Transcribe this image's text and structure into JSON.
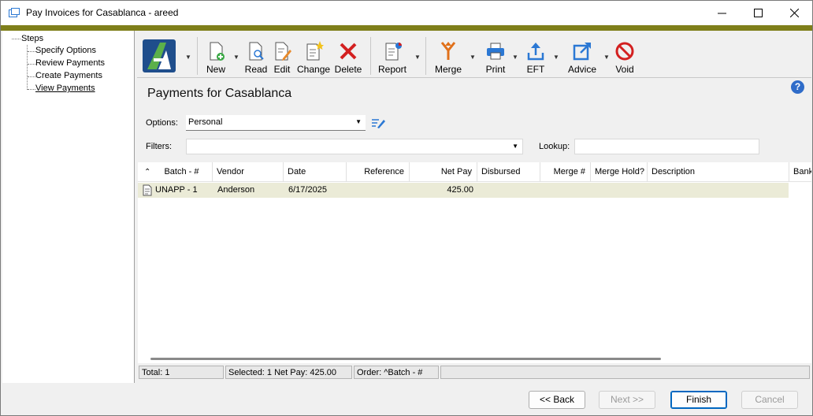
{
  "window": {
    "title": "Pay Invoices for Casablanca - areed",
    "minimize_icon": "minimize-icon",
    "maximize_icon": "maximize-icon",
    "close_icon": "close-icon"
  },
  "steps": {
    "root": "Steps",
    "items": [
      {
        "label": "Specify Options",
        "active": false
      },
      {
        "label": "Review Payments",
        "active": false
      },
      {
        "label": "Create Payments",
        "active": false
      },
      {
        "label": "View Payments",
        "active": true
      }
    ]
  },
  "toolbar": {
    "buttons": [
      {
        "label": "New",
        "icon": "new-document-icon"
      },
      {
        "label": "Read",
        "icon": "read-icon"
      },
      {
        "label": "Edit",
        "icon": "edit-icon"
      },
      {
        "label": "Change",
        "icon": "change-icon"
      },
      {
        "label": "Delete",
        "icon": "delete-icon"
      },
      {
        "label": "Report",
        "icon": "report-icon"
      },
      {
        "label": "Merge",
        "icon": "merge-icon"
      },
      {
        "label": "Print",
        "icon": "printer-icon"
      },
      {
        "label": "EFT",
        "icon": "eft-upload-icon"
      },
      {
        "label": "Advice",
        "icon": "advice-icon"
      },
      {
        "label": "Void",
        "icon": "void-icon"
      }
    ]
  },
  "page": {
    "heading": "Payments for Casablanca",
    "help": "?"
  },
  "filters": {
    "options_label": "Options:",
    "options_value": "Personal",
    "filters_label": "Filters:",
    "filters_value": "",
    "lookup_label": "Lookup:",
    "lookup_value": ""
  },
  "grid": {
    "columns": [
      "Batch - #",
      "Vendor",
      "Date",
      "Reference",
      "Net Pay",
      "Disbursed",
      "Merge #",
      "Merge Hold?",
      "Description",
      "Bank"
    ],
    "rows": [
      {
        "batch": "UNAPP - 1",
        "vendor": "Anderson",
        "date": "6/17/2025",
        "reference": "",
        "net_pay": "425.00",
        "disbursed": "",
        "merge": "",
        "merge_hold": "",
        "description": "",
        "bank": ""
      }
    ]
  },
  "status": {
    "total": "Total: 1",
    "selected": "Selected: 1  Net Pay: 425.00",
    "order": "Order: ^Batch - #",
    "extra": ""
  },
  "footer": {
    "back": "<< Back",
    "next": "Next >>",
    "finish": "Finish",
    "cancel": "Cancel"
  },
  "colors": {
    "accent_bar": "#7f7f1a",
    "selected_row": "#ebebd7",
    "help": "#2f6cc9"
  }
}
